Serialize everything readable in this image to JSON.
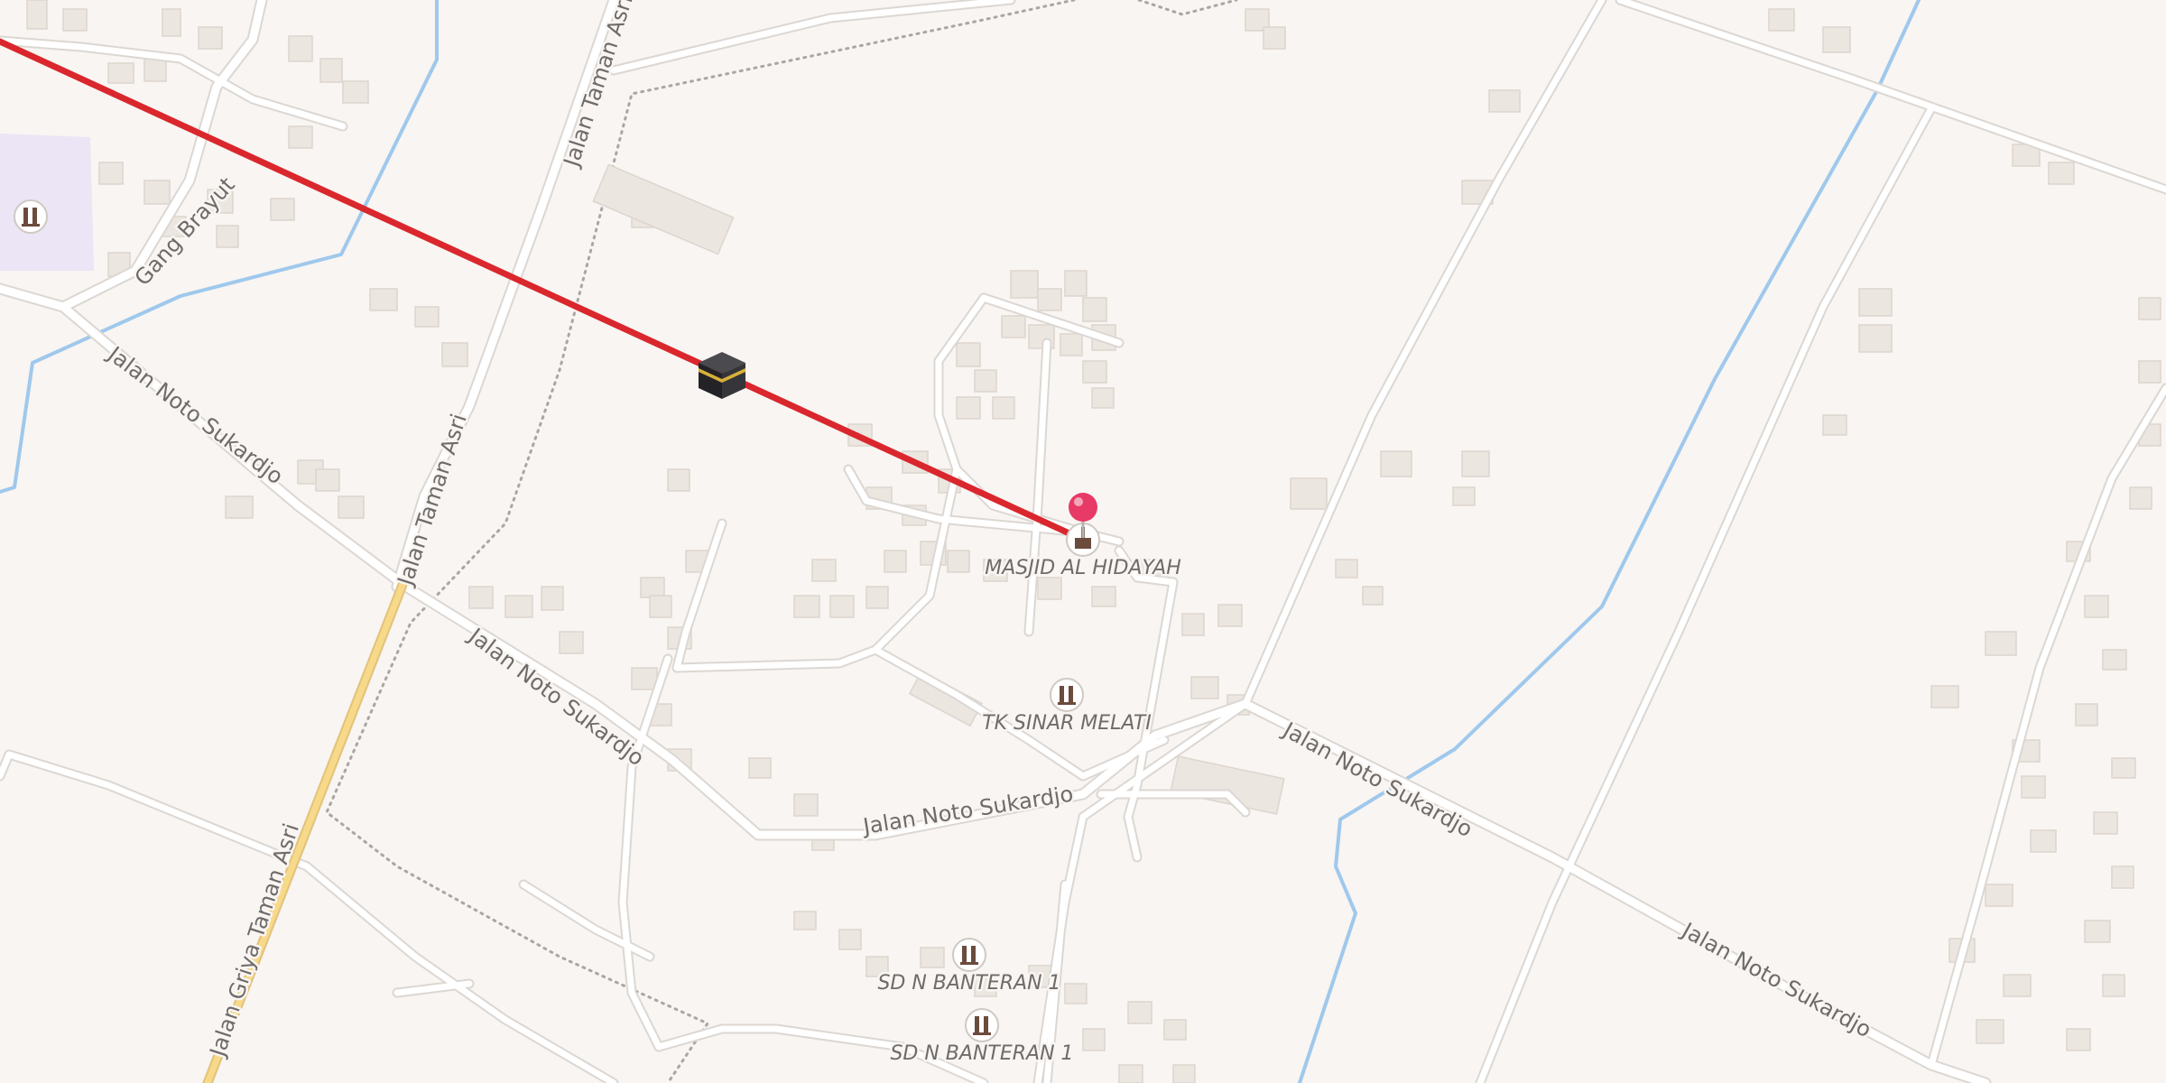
{
  "map": {
    "qibla_line_color": "#d9272d",
    "pin_color": "#e83a66",
    "highway_color": "#f7d98a",
    "water_color": "#9fc8ec",
    "kaaba_icon": "kaaba-icon",
    "pin_icon": "map-pin-icon",
    "poi_icon": "school-icon"
  },
  "streets": {
    "jalan_taman_asri_1": "Jalan Taman Asri",
    "jalan_taman_asri_2": "Jalan Taman Asri",
    "jalan_griya_taman_asri": "Jalan Griya Taman Asri",
    "gang_brayut": "Gang Brayut",
    "jalan_noto_sukardjo_1": "Jalan Noto Sukardjo",
    "jalan_noto_sukardjo_2": "Jalan Noto Sukardjo",
    "jalan_noto_sukardjo_3": "Jalan Noto Sukardjo",
    "jalan_noto_sukardjo_4": "Jalan Noto Sukardjo",
    "jalan_noto_sukardjo_5": "Jalan Noto Sukardjo"
  },
  "pois": {
    "masjid": "MASJID AL HIDAYAH",
    "tk_sinar_melati": "TK SINAR MELATI",
    "sd_n_banteran_1a": "SD N BANTERAN 1",
    "sd_n_banteran_1b": "SD N BANTERAN 1"
  }
}
